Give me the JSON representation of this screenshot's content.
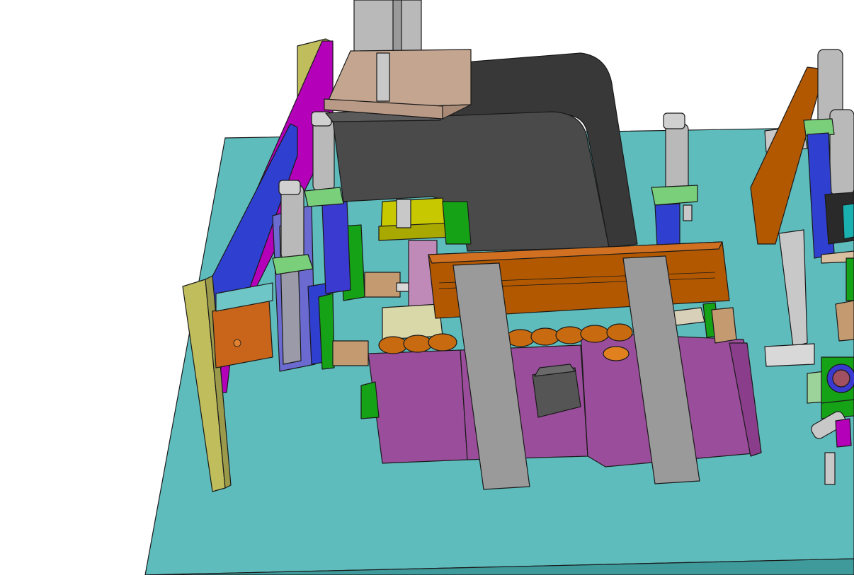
{
  "scene": {
    "description_free": true,
    "colors": {
      "base_plate": "#5fbcbd",
      "base_plate_edge": "#3e9a9b",
      "press_frame": "#4a4a4a",
      "press_frame_side": "#383838",
      "mount_block": "#c4a590",
      "magenta_plate": "#b400b8",
      "olive_plate": "#c0bd5c",
      "blue_rail": "#2f3fcf",
      "fixture_body": "#9a4d9a",
      "orange_slide": "#b25800",
      "grey_bar": "#9a9a9a",
      "cylinder": "#b9b9b9",
      "green_bracket": "#16a216",
      "yellow_block": "#c8c800",
      "copper_cup": "#c86a10",
      "motor": "#555555"
    }
  }
}
